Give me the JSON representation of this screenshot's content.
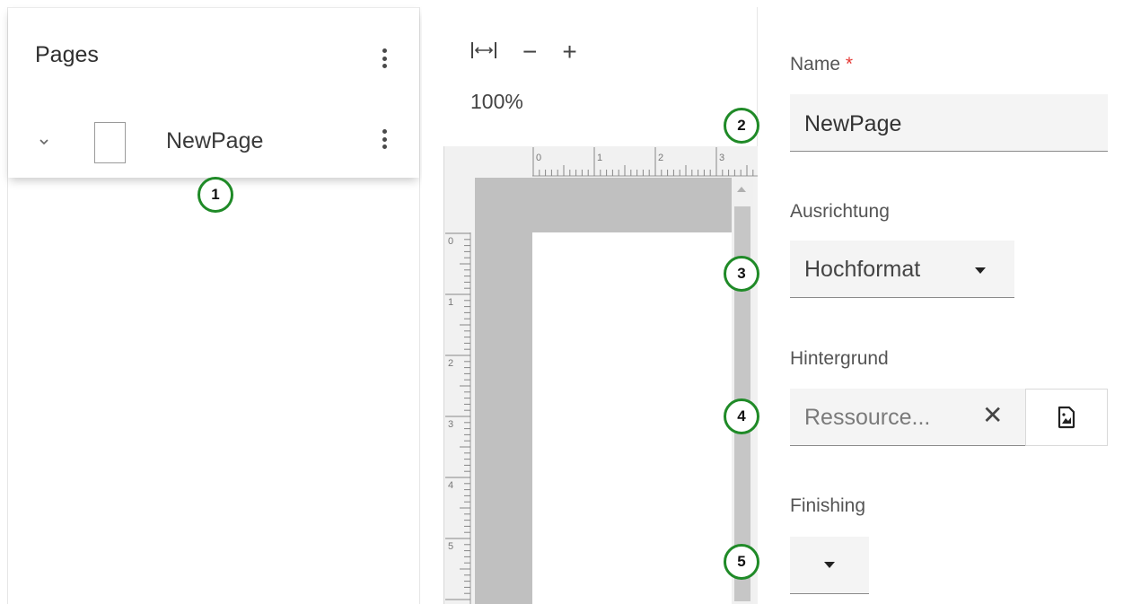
{
  "pages_panel": {
    "title": "Pages",
    "items": [
      {
        "name": "NewPage"
      }
    ]
  },
  "zoom": {
    "level": "100%",
    "tools": [
      {
        "name": "fit-width",
        "glyph": "|↔|"
      },
      {
        "name": "zoom-out",
        "glyph": "−"
      },
      {
        "name": "zoom-in",
        "glyph": "+"
      }
    ]
  },
  "ruler": {
    "top_labels": [
      "0",
      "1",
      "2",
      "3"
    ],
    "left_labels": [
      "0",
      "1",
      "2",
      "3",
      "4",
      "5"
    ]
  },
  "properties": {
    "name_label": "Name",
    "required_marker": "*",
    "name_value": "NewPage",
    "orientation_label": "Ausrichtung",
    "orientation_value": "Hochformat",
    "background_label": "Hintergrund",
    "background_placeholder": "Ressource...",
    "clear_glyph": "✕",
    "finishing_label": "Finishing",
    "finishing_value": ""
  },
  "callouts": [
    "1",
    "2",
    "3",
    "4",
    "5"
  ],
  "colors": {
    "callout_border": "#1f8a27",
    "required": "#e53935",
    "page_margin": "#c0c0c0"
  }
}
